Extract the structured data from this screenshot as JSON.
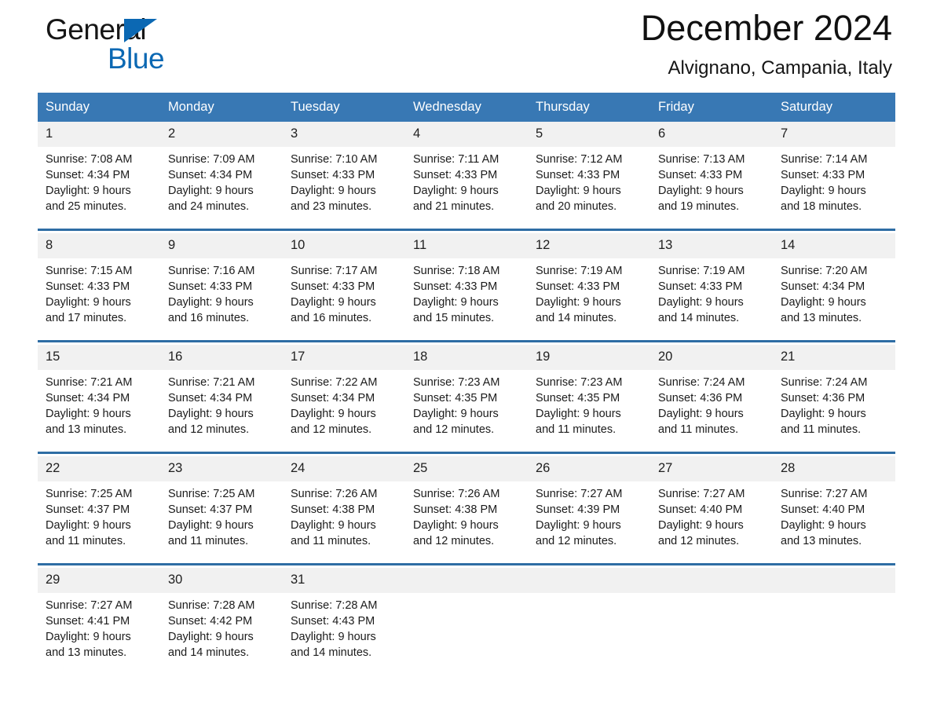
{
  "brand": {
    "name_part1": "General",
    "name_part2": "Blue",
    "accent_color": "#0b68b3"
  },
  "header": {
    "title": "December 2024",
    "location": "Alvignano, Campania, Italy"
  },
  "calendar": {
    "header_bg": "#3878b4",
    "separator_color": "#2e6da4",
    "daynum_bg": "#f1f1f1",
    "weekdays": [
      "Sunday",
      "Monday",
      "Tuesday",
      "Wednesday",
      "Thursday",
      "Friday",
      "Saturday"
    ],
    "weeks": [
      [
        {
          "day": "1",
          "detail": "Sunrise: 7:08 AM\nSunset: 4:34 PM\nDaylight: 9 hours\nand 25 minutes."
        },
        {
          "day": "2",
          "detail": "Sunrise: 7:09 AM\nSunset: 4:34 PM\nDaylight: 9 hours\nand 24 minutes."
        },
        {
          "day": "3",
          "detail": "Sunrise: 7:10 AM\nSunset: 4:33 PM\nDaylight: 9 hours\nand 23 minutes."
        },
        {
          "day": "4",
          "detail": "Sunrise: 7:11 AM\nSunset: 4:33 PM\nDaylight: 9 hours\nand 21 minutes."
        },
        {
          "day": "5",
          "detail": "Sunrise: 7:12 AM\nSunset: 4:33 PM\nDaylight: 9 hours\nand 20 minutes."
        },
        {
          "day": "6",
          "detail": "Sunrise: 7:13 AM\nSunset: 4:33 PM\nDaylight: 9 hours\nand 19 minutes."
        },
        {
          "day": "7",
          "detail": "Sunrise: 7:14 AM\nSunset: 4:33 PM\nDaylight: 9 hours\nand 18 minutes."
        }
      ],
      [
        {
          "day": "8",
          "detail": "Sunrise: 7:15 AM\nSunset: 4:33 PM\nDaylight: 9 hours\nand 17 minutes."
        },
        {
          "day": "9",
          "detail": "Sunrise: 7:16 AM\nSunset: 4:33 PM\nDaylight: 9 hours\nand 16 minutes."
        },
        {
          "day": "10",
          "detail": "Sunrise: 7:17 AM\nSunset: 4:33 PM\nDaylight: 9 hours\nand 16 minutes."
        },
        {
          "day": "11",
          "detail": "Sunrise: 7:18 AM\nSunset: 4:33 PM\nDaylight: 9 hours\nand 15 minutes."
        },
        {
          "day": "12",
          "detail": "Sunrise: 7:19 AM\nSunset: 4:33 PM\nDaylight: 9 hours\nand 14 minutes."
        },
        {
          "day": "13",
          "detail": "Sunrise: 7:19 AM\nSunset: 4:33 PM\nDaylight: 9 hours\nand 14 minutes."
        },
        {
          "day": "14",
          "detail": "Sunrise: 7:20 AM\nSunset: 4:34 PM\nDaylight: 9 hours\nand 13 minutes."
        }
      ],
      [
        {
          "day": "15",
          "detail": "Sunrise: 7:21 AM\nSunset: 4:34 PM\nDaylight: 9 hours\nand 13 minutes."
        },
        {
          "day": "16",
          "detail": "Sunrise: 7:21 AM\nSunset: 4:34 PM\nDaylight: 9 hours\nand 12 minutes."
        },
        {
          "day": "17",
          "detail": "Sunrise: 7:22 AM\nSunset: 4:34 PM\nDaylight: 9 hours\nand 12 minutes."
        },
        {
          "day": "18",
          "detail": "Sunrise: 7:23 AM\nSunset: 4:35 PM\nDaylight: 9 hours\nand 12 minutes."
        },
        {
          "day": "19",
          "detail": "Sunrise: 7:23 AM\nSunset: 4:35 PM\nDaylight: 9 hours\nand 11 minutes."
        },
        {
          "day": "20",
          "detail": "Sunrise: 7:24 AM\nSunset: 4:36 PM\nDaylight: 9 hours\nand 11 minutes."
        },
        {
          "day": "21",
          "detail": "Sunrise: 7:24 AM\nSunset: 4:36 PM\nDaylight: 9 hours\nand 11 minutes."
        }
      ],
      [
        {
          "day": "22",
          "detail": "Sunrise: 7:25 AM\nSunset: 4:37 PM\nDaylight: 9 hours\nand 11 minutes."
        },
        {
          "day": "23",
          "detail": "Sunrise: 7:25 AM\nSunset: 4:37 PM\nDaylight: 9 hours\nand 11 minutes."
        },
        {
          "day": "24",
          "detail": "Sunrise: 7:26 AM\nSunset: 4:38 PM\nDaylight: 9 hours\nand 11 minutes."
        },
        {
          "day": "25",
          "detail": "Sunrise: 7:26 AM\nSunset: 4:38 PM\nDaylight: 9 hours\nand 12 minutes."
        },
        {
          "day": "26",
          "detail": "Sunrise: 7:27 AM\nSunset: 4:39 PM\nDaylight: 9 hours\nand 12 minutes."
        },
        {
          "day": "27",
          "detail": "Sunrise: 7:27 AM\nSunset: 4:40 PM\nDaylight: 9 hours\nand 12 minutes."
        },
        {
          "day": "28",
          "detail": "Sunrise: 7:27 AM\nSunset: 4:40 PM\nDaylight: 9 hours\nand 13 minutes."
        }
      ],
      [
        {
          "day": "29",
          "detail": "Sunrise: 7:27 AM\nSunset: 4:41 PM\nDaylight: 9 hours\nand 13 minutes."
        },
        {
          "day": "30",
          "detail": "Sunrise: 7:28 AM\nSunset: 4:42 PM\nDaylight: 9 hours\nand 14 minutes."
        },
        {
          "day": "31",
          "detail": "Sunrise: 7:28 AM\nSunset: 4:43 PM\nDaylight: 9 hours\nand 14 minutes."
        },
        {
          "day": "",
          "detail": ""
        },
        {
          "day": "",
          "detail": ""
        },
        {
          "day": "",
          "detail": ""
        },
        {
          "day": "",
          "detail": ""
        }
      ]
    ]
  }
}
